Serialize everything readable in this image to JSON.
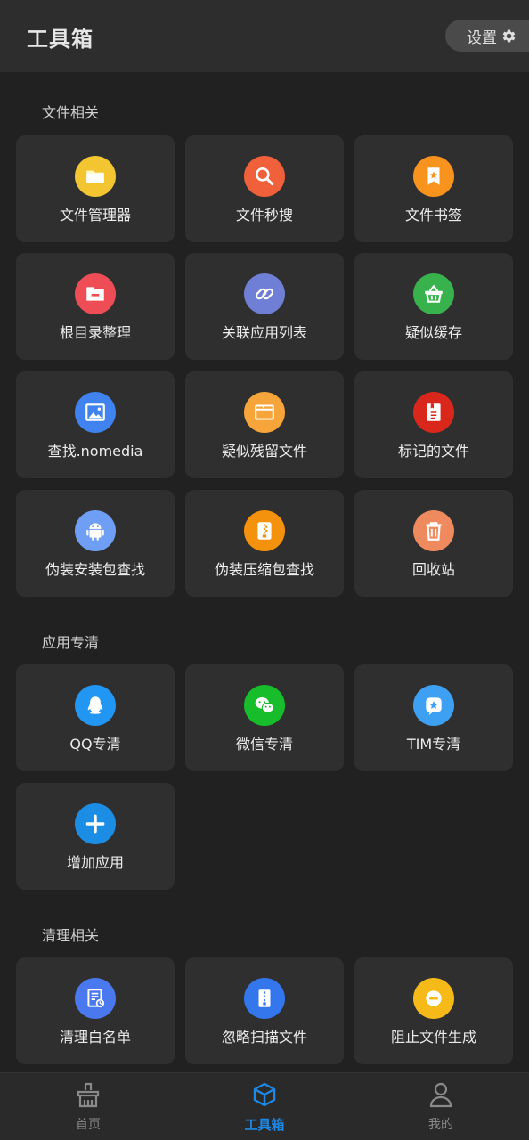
{
  "header": {
    "title": "工具箱",
    "settings_label": "设置"
  },
  "sections": [
    {
      "title": "文件相关"
    },
    {
      "title": "应用专清"
    },
    {
      "title": "清理相关"
    }
  ],
  "cards": [
    {
      "label": "文件管理器",
      "icon": "folder-icon",
      "color": "#f2c531"
    },
    {
      "label": "文件秒搜",
      "icon": "magnifier-icon",
      "color": "#f0603a"
    },
    {
      "label": "文件书签",
      "icon": "bookmark-icon",
      "color": "#f8931d"
    },
    {
      "label": "根目录整理",
      "icon": "folder-minus-icon",
      "color": "#ef4d56"
    },
    {
      "label": "关联应用列表",
      "icon": "link-icon",
      "color": "#6f7fd6"
    },
    {
      "label": "疑似缓存",
      "icon": "basket-icon",
      "color": "#37b24d"
    },
    {
      "label": "查找.nomedia",
      "icon": "image-icon",
      "color": "#3f82f0"
    },
    {
      "label": "疑似残留文件",
      "icon": "window-icon",
      "color": "#f5a53a"
    },
    {
      "label": "标记的文件",
      "icon": "document-mark-icon",
      "color": "#d9271b"
    },
    {
      "label": "伪装安装包查找",
      "icon": "android-icon",
      "color": "#6f9ff5"
    },
    {
      "label": "伪装压缩包查找",
      "icon": "zip-icon",
      "color": "#f5920d"
    },
    {
      "label": "回收站",
      "icon": "trash-icon",
      "color": "#ee8a5e"
    },
    {
      "label": "QQ专清",
      "icon": "qq-icon",
      "color": "#2196f3"
    },
    {
      "label": "微信专清",
      "icon": "wechat-icon",
      "color": "#18bd2c"
    },
    {
      "label": "TIM专清",
      "icon": "tim-icon",
      "color": "#3ea0f2"
    },
    {
      "label": "增加应用",
      "icon": "plus-icon",
      "color": "#1b8de4"
    },
    {
      "label": "清理白名单",
      "icon": "whitelist-icon",
      "color": "#4a78ee"
    },
    {
      "label": "忽略扫描文件",
      "icon": "zip-file-icon",
      "color": "#3476ec"
    },
    {
      "label": "阻止文件生成",
      "icon": "block-icon",
      "color": "#f5b918"
    }
  ],
  "nav": [
    {
      "label": "首页",
      "icon": "broom-icon"
    },
    {
      "label": "工具箱",
      "icon": "box-icon"
    },
    {
      "label": "我的",
      "icon": "person-icon"
    }
  ],
  "colors": {
    "accent": "#1e88e5",
    "card_bg": "#2f2f2f",
    "page_bg": "#212121"
  }
}
